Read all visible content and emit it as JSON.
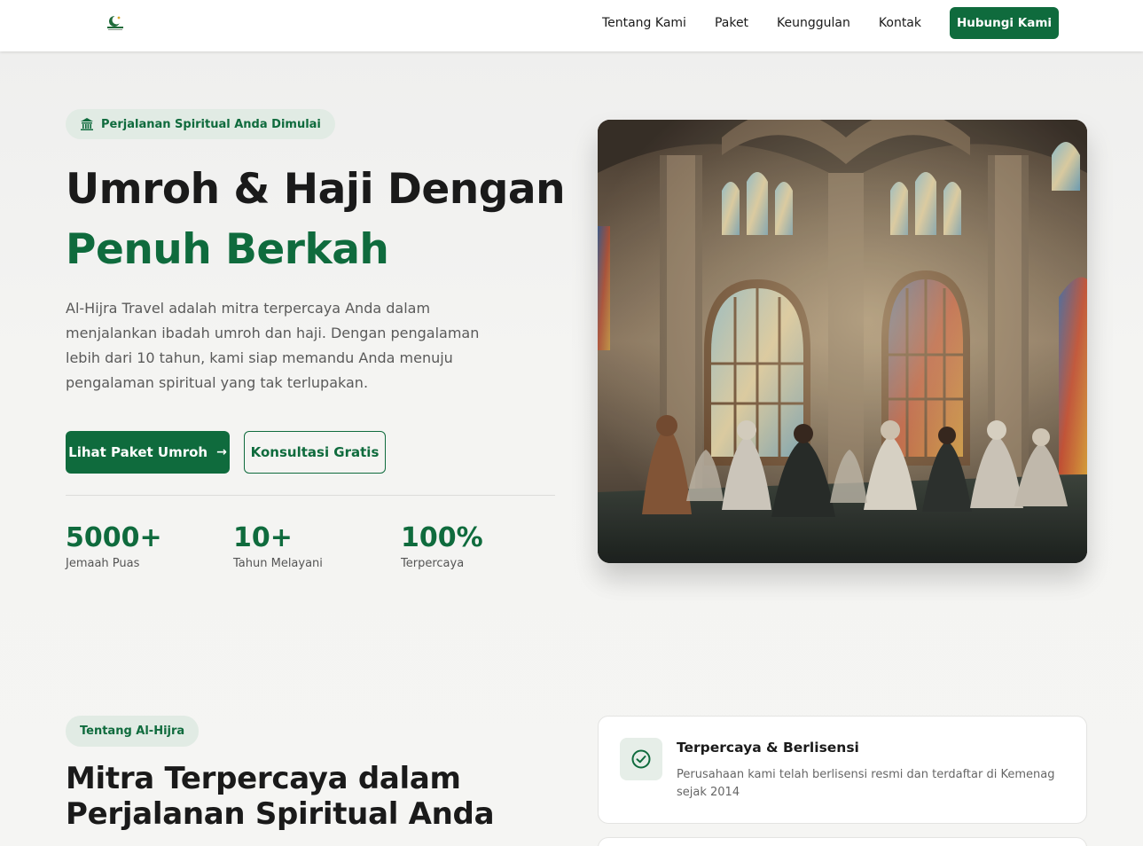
{
  "nav": {
    "links": [
      "Tentang Kami",
      "Paket",
      "Keunggulan",
      "Kontak"
    ],
    "cta": "Hubungi Kami"
  },
  "hero": {
    "badge": "Perjalanan Spiritual Anda Dimulai",
    "title_line1": "Umroh & Haji Dengan",
    "title_line2": "Penuh Berkah",
    "description": "Al-Hijra Travel adalah mitra terpercaya Anda dalam menjalankan ibadah umroh dan haji. Dengan pengalaman lebih dari 10 tahun, kami siap memandu Anda menuju pengalaman spiritual yang tak terlupakan.",
    "primary_button": "Lihat Paket Umroh",
    "secondary_button": "Konsultasi Gratis",
    "stats": [
      {
        "value": "5000+",
        "label": "Jemaah Puas"
      },
      {
        "value": "10+",
        "label": "Tahun Melayani"
      },
      {
        "value": "100%",
        "label": "Terpercaya"
      }
    ]
  },
  "about": {
    "badge": "Tentang Al-Hijra",
    "title": "Mitra Terpercaya dalam Perjalanan Spiritual Anda",
    "cards": [
      {
        "title": "Terpercaya & Berlisensi",
        "text": "Perusahaan kami telah berlisensi resmi dan terdaftar di Kemenag sejak 2014"
      }
    ]
  },
  "colors": {
    "brand": "#0f6b3d",
    "badge_bg": "#e1ebe4",
    "background": "#f3f3f2"
  },
  "icons": [
    "crescent-logo-icon",
    "mosque-icon",
    "arrow-right-icon",
    "check-circle-icon"
  ]
}
